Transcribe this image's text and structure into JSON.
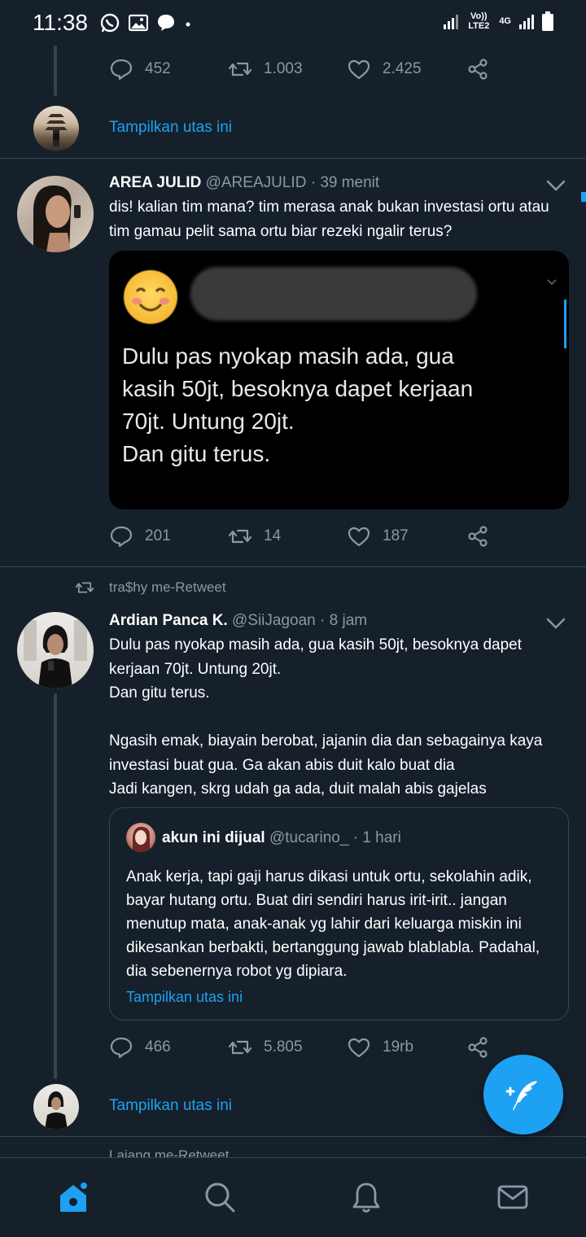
{
  "status_bar": {
    "time": "11:38",
    "network_tag_1": "Vo)) LTE2",
    "network_tag_2": "4G"
  },
  "tweet_prev": {
    "replies": "452",
    "retweets": "1.003",
    "likes": "2.425",
    "show_thread": "Tampilkan utas ini"
  },
  "tweet1": {
    "name": "AREA JULID",
    "handle": "@AREAJULID",
    "separator": "·",
    "time": "39 menit",
    "text_line1": "dis! kalian tim mana? tim merasa anak bukan investasi ortu atau",
    "text_line2": "tim gamau pelit sama ortu biar rezeki ngalir terus?",
    "media_text": [
      "Dulu pas nyokap masih ada, gua",
      "kasih 50jt, besoknya dapet kerjaan",
      "70jt. Untung 20jt.",
      "Dan gitu terus."
    ],
    "replies": "201",
    "retweets": "14",
    "likes": "187"
  },
  "retweet_label": "tra$hy me-Retweet",
  "tweet2": {
    "name": "Ardian Panca K.",
    "handle": "@SiiJagoan",
    "separator": "·",
    "time": "8 jam",
    "lines": [
      "Dulu pas nyokap masih ada, gua kasih 50jt, besoknya dapet",
      "kerjaan 70jt. Untung 20jt.",
      "Dan gitu terus.",
      "",
      "Ngasih emak, biayain berobat, jajanin dia dan sebagainya kaya",
      "investasi buat gua. Ga akan abis duit kalo buat dia",
      "Jadi kangen, skrg udah ga ada, duit malah abis gajelas"
    ],
    "quote": {
      "name": "akun ini dijual",
      "handle": "@tucarino_",
      "separator": "·",
      "time": "1 hari",
      "lines": [
        "Anak kerja, tapi gaji harus dikasi untuk ortu, sekolahin adik,",
        "bayar hutang ortu. Buat diri sendiri harus irit-irit.. jangan",
        "menutup mata, anak-anak yg lahir dari keluarga miskin ini",
        "dikesankan berbakti, bertanggung jawab blablabla. Padahal,",
        "dia sebenernya robot yg dipiara."
      ],
      "show_thread": "Tampilkan utas ini"
    },
    "replies": "466",
    "retweets": "5.805",
    "likes": "19rb",
    "show_thread": "Tampilkan utas ini"
  },
  "retweet_label_2": "Lajang me-Retweet",
  "colors": {
    "background": "#15202b",
    "accent": "#1da1f2",
    "muted": "#8899a6",
    "border": "#38444d"
  },
  "icons": {
    "nav": [
      "home-icon",
      "search-icon",
      "bell-icon",
      "mail-icon"
    ],
    "fab": "compose-tweet-icon"
  }
}
